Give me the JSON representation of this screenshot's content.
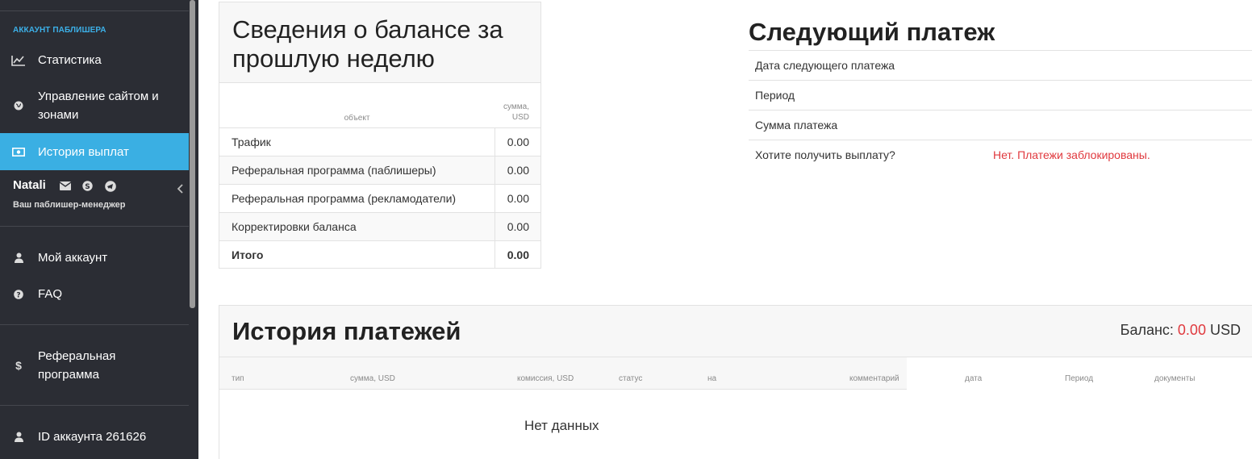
{
  "sidebar": {
    "section_title": "АККАУНТ ПАБЛИШЕРА",
    "items": [
      {
        "label": "Статистика",
        "icon": "line-chart-icon"
      },
      {
        "label": "Управление сайтом и зонами",
        "icon": "globe-icon"
      },
      {
        "label": "История выплат",
        "icon": "money-icon",
        "active": true
      },
      {
        "label": "Мой аккаунт",
        "icon": "user-icon"
      },
      {
        "label": "FAQ",
        "icon": "question-circle-icon"
      },
      {
        "label": "Реферальная программа",
        "icon": "dollar-icon"
      },
      {
        "label": "ID аккаунта 261626",
        "icon": "user-icon"
      }
    ],
    "manager": {
      "name": "Natali",
      "role": "Ваш паблишер-менеджер",
      "icons": [
        "envelope-icon",
        "skype-icon",
        "telegram-icon"
      ]
    }
  },
  "balance": {
    "title": "Сведения о балансе за прошлую неделю",
    "col_object": "объект",
    "col_sum": "сумма, USD",
    "rows": [
      {
        "label": "Трафик",
        "value": "0.00"
      },
      {
        "label": "Реферальная программа (паблишеры)",
        "value": "0.00"
      },
      {
        "label": "Реферальная программа (рекламодатели)",
        "value": "0.00"
      },
      {
        "label": "Корректировки баланса",
        "value": "0.00"
      },
      {
        "label": "Итого",
        "value": "0.00"
      }
    ]
  },
  "next_payment": {
    "title": "Следующий платеж",
    "rows": [
      {
        "label": "Дата следующего платежа",
        "value": ""
      },
      {
        "label": "Период",
        "value": ""
      },
      {
        "label": "Сумма платежа",
        "value": ""
      },
      {
        "label": "Хотите получить выплату?",
        "value": "Нет. Платежи заблокированы."
      }
    ]
  },
  "history": {
    "title": "История платежей",
    "balance_label": "Баланс:",
    "balance_amount": "0.00",
    "balance_currency": "USD",
    "columns": [
      "тип",
      "сумма, USD",
      "комиссия, USD",
      "статус",
      "на",
      "комментарий",
      "дата",
      "Период",
      "документы"
    ],
    "empty_text": "Нет данных"
  },
  "colors": {
    "sidebar_bg": "#2b2d34",
    "accent": "#3aafe3",
    "danger": "#e0393e"
  }
}
